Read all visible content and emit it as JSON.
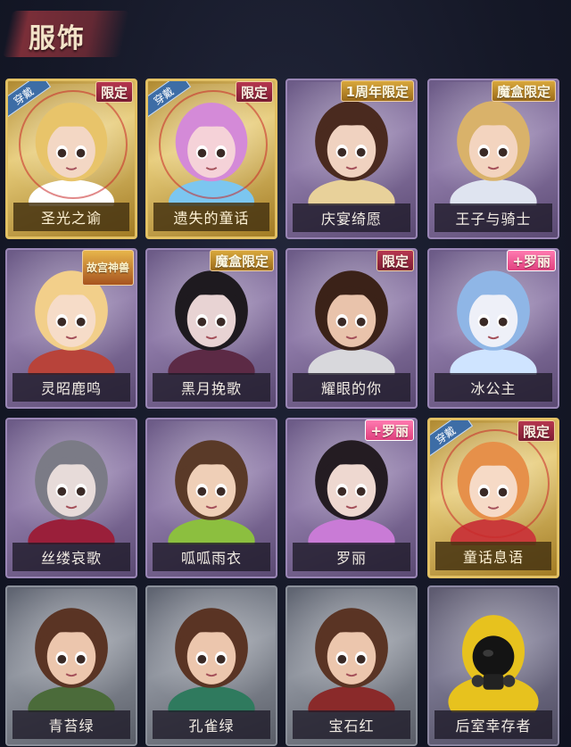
{
  "header": {
    "title": "服饰"
  },
  "badges": {
    "limited": "限定",
    "anniversary": "1周年限定",
    "magic_box": "魔盒限定",
    "gugong": "故宫神兽",
    "luoli": "+罗丽",
    "wearing": "穿戴"
  },
  "outfits": [
    {
      "name": "圣光之谕",
      "frame": "gold",
      "wearing": true,
      "badge": "limited",
      "hair": "#e8c46a",
      "skin": "#f3d7c4",
      "accent": "#ffffff"
    },
    {
      "name": "遗失的童话",
      "frame": "gold",
      "wearing": true,
      "badge": "limited",
      "hair": "#d48ad8",
      "skin": "#f5d2d8",
      "accent": "#7cc6f0"
    },
    {
      "name": "庆宴绮愿",
      "frame": "purple",
      "wearing": false,
      "badge": "anniversary",
      "hair": "#4a2a1f",
      "skin": "#f0d2c0",
      "accent": "#e8d19a"
    },
    {
      "name": "王子与骑士",
      "frame": "purple",
      "wearing": false,
      "badge": "magic_box",
      "hair": "#d9b26a",
      "skin": "#f3d4bf",
      "accent": "#dfe4f0"
    },
    {
      "name": "灵昭鹿鸣",
      "frame": "purple",
      "wearing": false,
      "badge": "gugong",
      "hair": "#f2cf8a",
      "skin": "#f6dcc8",
      "accent": "#b8433a"
    },
    {
      "name": "黑月挽歌",
      "frame": "purple",
      "wearing": false,
      "badge": "magic_box",
      "hair": "#1e1a1f",
      "skin": "#e8d3d3",
      "accent": "#5c2a45"
    },
    {
      "name": "耀眼的你",
      "frame": "purple",
      "wearing": false,
      "badge": "limited",
      "hair": "#3b2218",
      "skin": "#e9c3ab",
      "accent": "#d8d8dc"
    },
    {
      "name": "冰公主",
      "frame": "purple",
      "wearing": false,
      "badge": "luoli",
      "hair": "#8fb6e6",
      "skin": "#eef0f8",
      "accent": "#cfe4ff"
    },
    {
      "name": "丝缕哀歌",
      "frame": "purple",
      "wearing": false,
      "badge": "",
      "hair": "#7b7b86",
      "skin": "#e7dbd9",
      "accent": "#9a1f3a"
    },
    {
      "name": "呱呱雨衣",
      "frame": "purple",
      "wearing": false,
      "badge": "",
      "hair": "#5a3a28",
      "skin": "#efcfb7",
      "accent": "#8cbf3f"
    },
    {
      "name": "罗丽",
      "frame": "purple",
      "wearing": false,
      "badge": "luoli",
      "hair": "#241c22",
      "skin": "#eed8d0",
      "accent": "#c97bd6"
    },
    {
      "name": "童话息语",
      "frame": "gold",
      "wearing": true,
      "badge": "limited",
      "hair": "#e6904a",
      "skin": "#f6dac6",
      "accent": "#c93a3a"
    },
    {
      "name": "青苔绿",
      "frame": "gray",
      "wearing": false,
      "badge": "",
      "hair": "#5a3424",
      "skin": "#ecc6ad",
      "accent": "#4b6b3a"
    },
    {
      "name": "孔雀绿",
      "frame": "gray",
      "wearing": false,
      "badge": "",
      "hair": "#5a3424",
      "skin": "#ecc6ad",
      "accent": "#2f7a5e"
    },
    {
      "name": "宝石红",
      "frame": "gray",
      "wearing": false,
      "badge": "",
      "hair": "#5a3424",
      "skin": "#ecc6ad",
      "accent": "#8a2a2a"
    },
    {
      "name": "后室幸存者",
      "frame": "yellow-bg",
      "wearing": false,
      "badge": "",
      "hair": "#e7c21e",
      "skin": "#1b1b1b",
      "accent": "#e7c21e"
    }
  ]
}
